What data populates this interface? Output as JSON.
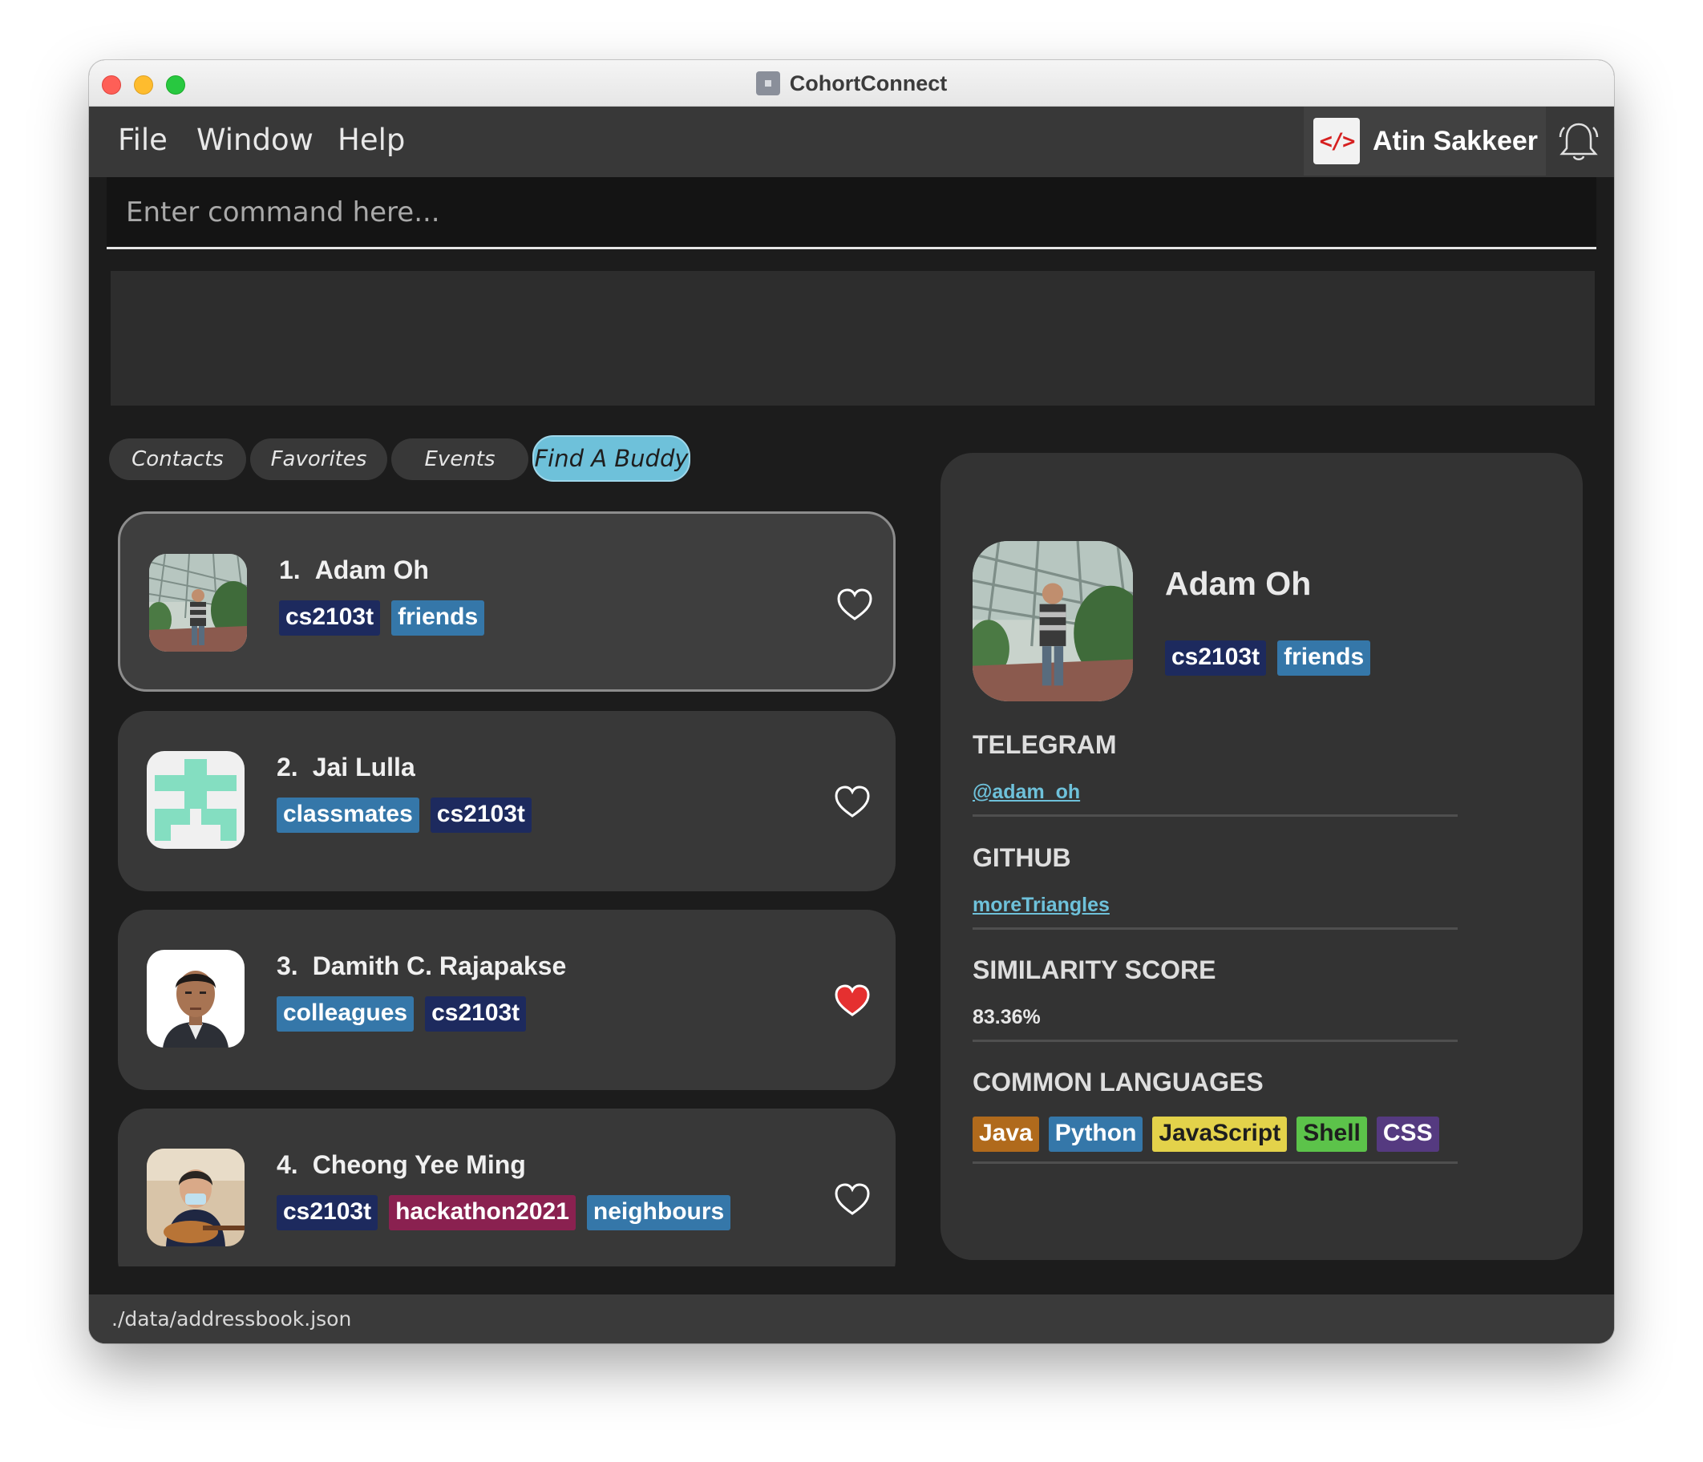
{
  "window": {
    "title": "CohortConnect"
  },
  "menu": {
    "file": "File",
    "window": "Window",
    "help": "Help"
  },
  "user": {
    "logo_text": "</>",
    "name": "Atin Sakkeer"
  },
  "command": {
    "placeholder": "Enter command here..."
  },
  "tabs": [
    {
      "label": "Contacts",
      "active": false
    },
    {
      "label": "Favorites",
      "active": false
    },
    {
      "label": "Events",
      "active": false
    },
    {
      "label": "Find A Buddy",
      "active": true
    }
  ],
  "contacts": [
    {
      "index": "1.",
      "name": "Adam Oh",
      "favorite": false,
      "selected": true,
      "tags": [
        {
          "label": "cs2103t",
          "color": "#1d2a5e"
        },
        {
          "label": "friends",
          "color": "#3577a9"
        }
      ]
    },
    {
      "index": "2.",
      "name": "Jai Lulla",
      "favorite": false,
      "selected": false,
      "tags": [
        {
          "label": "classmates",
          "color": "#3577a9"
        },
        {
          "label": "cs2103t",
          "color": "#1d2a5e"
        }
      ]
    },
    {
      "index": "3.",
      "name": "Damith C. Rajapakse",
      "favorite": true,
      "selected": false,
      "tags": [
        {
          "label": "colleagues",
          "color": "#3577a9"
        },
        {
          "label": "cs2103t",
          "color": "#1d2a5e"
        }
      ]
    },
    {
      "index": "4.",
      "name": "Cheong Yee Ming",
      "favorite": false,
      "selected": false,
      "tags": [
        {
          "label": "cs2103t",
          "color": "#1d2a5e"
        },
        {
          "label": "hackathon2021",
          "color": "#8a2150"
        },
        {
          "label": "neighbours",
          "color": "#3577a9"
        }
      ]
    }
  ],
  "detail": {
    "name": "Adam Oh",
    "tags": [
      {
        "label": "cs2103t",
        "color": "#1d2a5e"
      },
      {
        "label": "friends",
        "color": "#3577a9"
      }
    ],
    "telegram_label": "TELEGRAM",
    "telegram_value": "@adam_oh",
    "github_label": "GITHUB",
    "github_value": "moreTriangles",
    "similarity_label": "SIMILARITY SCORE",
    "similarity_value": "83.36%",
    "languages_label": "COMMON LANGUAGES",
    "languages": [
      {
        "label": "Java",
        "color": "#b06a1c",
        "text_color": "#ffffff"
      },
      {
        "label": "Python",
        "color": "#3577a9",
        "text_color": "#ffffff"
      },
      {
        "label": "JavaScript",
        "color": "#e3d24a",
        "text_color": "#1e1e1e"
      },
      {
        "label": "Shell",
        "color": "#5cc34a",
        "text_color": "#1e1e1e"
      },
      {
        "label": "CSS",
        "color": "#553a80",
        "text_color": "#ffffff"
      }
    ]
  },
  "status": {
    "path": "./data/addressbook.json"
  },
  "colors": {
    "accent": "#6ec1da",
    "favorite": "#e53030"
  }
}
